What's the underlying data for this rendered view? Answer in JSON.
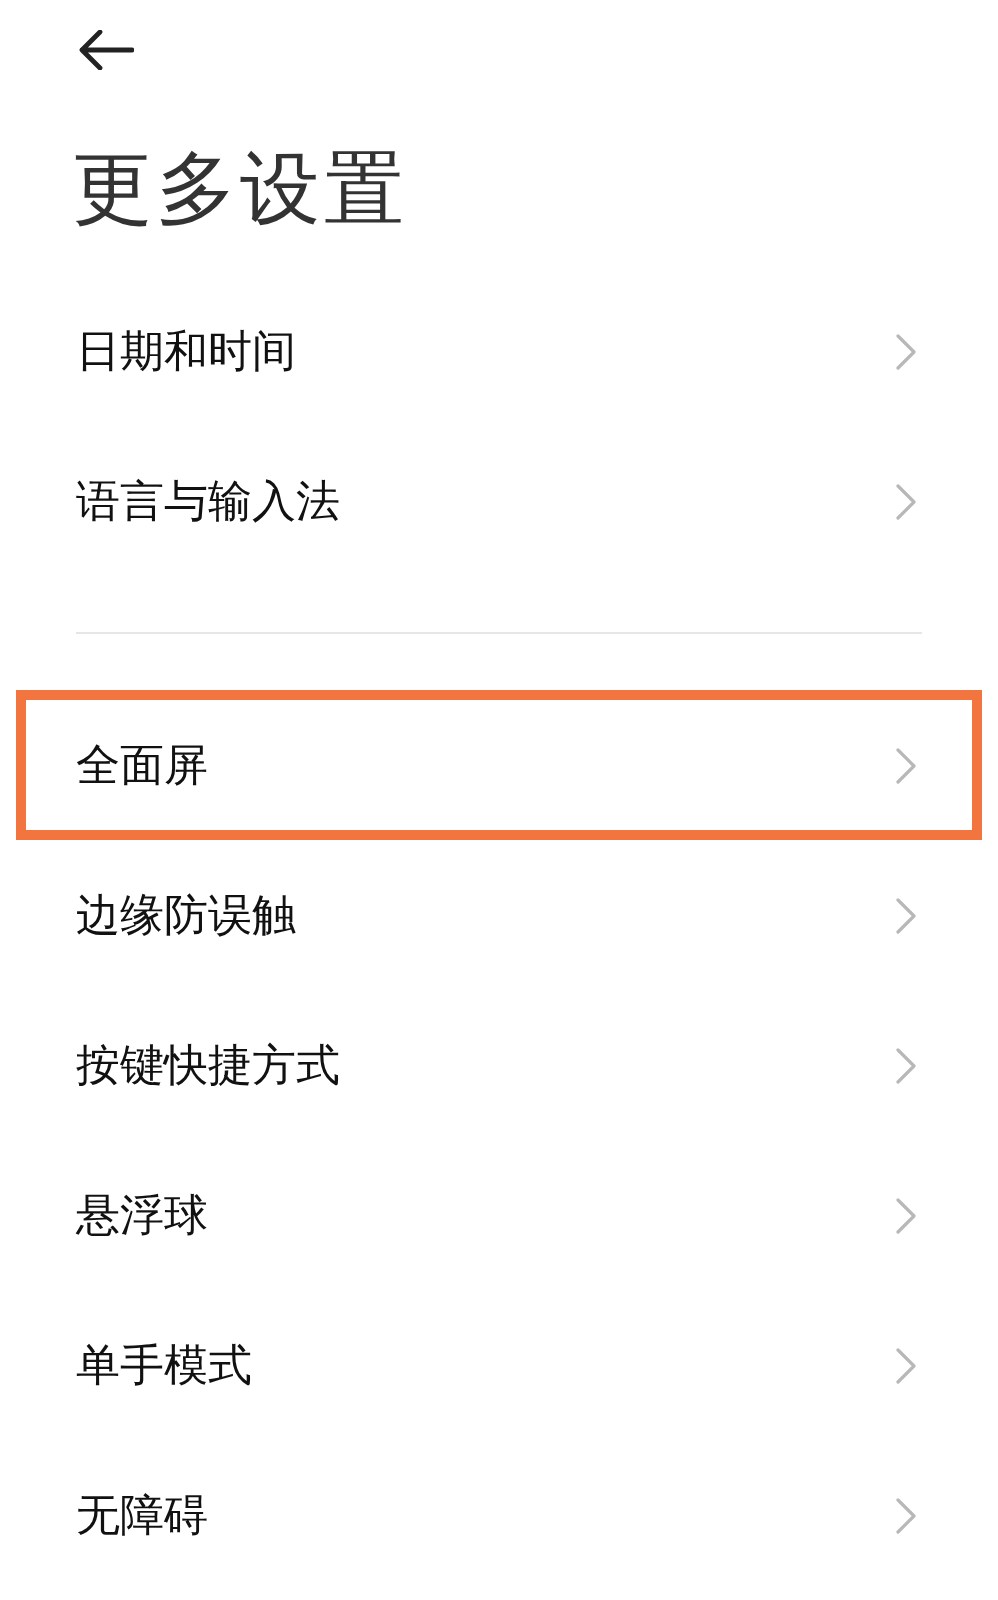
{
  "title": "更多设置",
  "groups": [
    {
      "items": [
        {
          "label": "日期和时间",
          "highlighted": false
        },
        {
          "label": "语言与输入法",
          "highlighted": false
        }
      ]
    },
    {
      "items": [
        {
          "label": "全面屏",
          "highlighted": true
        },
        {
          "label": "边缘防误触",
          "highlighted": false
        },
        {
          "label": "按键快捷方式",
          "highlighted": false
        },
        {
          "label": "悬浮球",
          "highlighted": false
        },
        {
          "label": "单手模式",
          "highlighted": false
        },
        {
          "label": "无障碍",
          "highlighted": false
        }
      ]
    }
  ]
}
